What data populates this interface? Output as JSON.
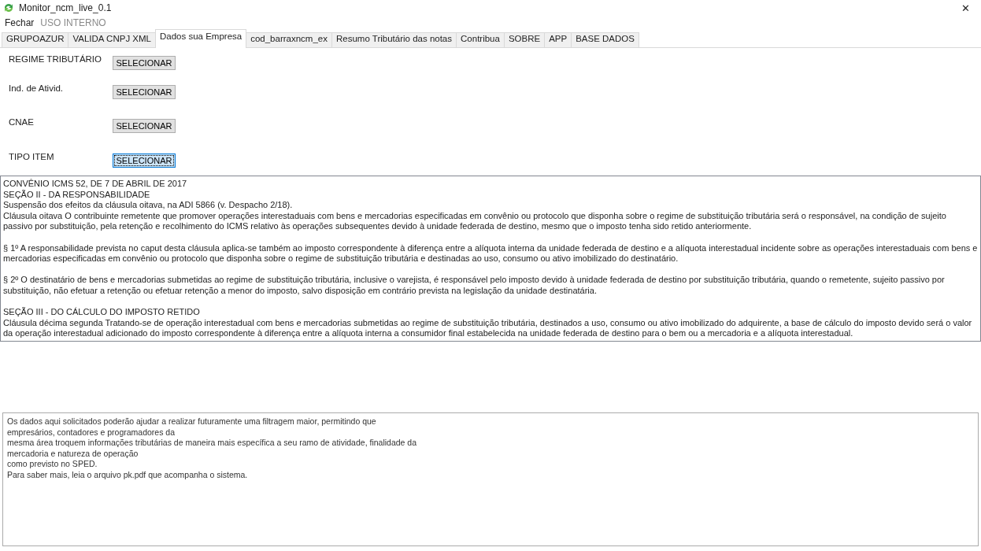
{
  "window": {
    "title": "Monitor_ncm_live_0.1",
    "close": "✕"
  },
  "menu": [
    {
      "label": "Fechar",
      "disabled": false
    },
    {
      "label": "USO INTERNO",
      "disabled": true
    }
  ],
  "tabs": [
    {
      "label": "GRUPOAZUR",
      "selected": false
    },
    {
      "label": "VALIDA CNPJ XML",
      "selected": false
    },
    {
      "label": "Dados sua Empresa",
      "selected": true
    },
    {
      "label": "cod_barraxncm_ex",
      "selected": false
    },
    {
      "label": "Resumo Tributário das notas",
      "selected": false
    },
    {
      "label": "Contribua",
      "selected": false
    },
    {
      "label": "SOBRE",
      "selected": false
    },
    {
      "label": "APP",
      "selected": false
    },
    {
      "label": "BASE DADOS",
      "selected": false
    }
  ],
  "form": [
    {
      "label": "REGIME TRIBUTÁRIO",
      "button": "SELECIONAR",
      "focused": false
    },
    {
      "label": "Ind. de Ativid.",
      "button": "SELECIONAR",
      "focused": false
    },
    {
      "label": "CNAE",
      "button": "SELECIONAR",
      "focused": false
    },
    {
      "label": "TIPO ITEM",
      "button": "SELECIONAR",
      "focused": true
    }
  ],
  "legal_text": [
    [
      "CONVÊNIO ICMS 52, DE 7 DE ABRIL DE 2017",
      "SEÇÃO II - DA RESPONSABILIDADE",
      "Suspensão dos efeitos da cláusula oitava, na ADI 5866 (v. Despacho 2/18).",
      "Cláusula oitava O contribuinte remetente que promover operações interestaduais com bens e mercadorias especificadas em convênio ou protocolo que disponha sobre o regime de substituição tributária será o responsável, na condição de sujeito passivo por substituição, pela retenção e recolhimento do ICMS relativo às operações subsequentes devido à unidade federada de destino, mesmo que o imposto tenha sido retido anteriormente."
    ],
    [
      "§ 1º A responsabilidade prevista no caput desta cláusula aplica-se também ao imposto correspondente à diferença entre a alíquota interna da unidade federada de destino e a alíquota interestadual incidente sobre as operações interestaduais com bens e mercadorias especificadas em convênio ou protocolo que disponha sobre o regime de substituição tributária e destinadas ao uso, consumo ou ativo imobilizado do destinatário."
    ],
    [
      "§ 2º O destinatário de bens e mercadorias submetidas ao regime de substituição tributária, inclusive o varejista, é responsável pelo imposto devido à unidade federada de destino por substituição tributária, quando o remetente, sujeito passivo por substituição, não efetuar a retenção ou efetuar retenção a menor do imposto, salvo disposição em contrário prevista na legislação da unidade destinatária."
    ],
    [
      "SEÇÃO III - DO CÁLCULO DO IMPOSTO RETIDO",
      "Cláusula décima segunda Tratando-se de operação interestadual com bens e mercadorias submetidas ao regime de substituição tributária, destinados a uso, consumo ou ativo imobilizado do adquirente, a base de cálculo do imposto devido será o valor da operação interestadual adicionado do imposto correspondente à diferença entre a alíquota interna a consumidor final estabelecida na unidade federada de destino para o bem ou a mercadoria e a alíquota interestadual."
    ]
  ],
  "note": "Os dados aqui solicitados poderão ajudar a realizar futuramente uma filtragem maior, permitindo que\nempresários, contadores e programadores da\nmesma área troquem informações tributárias de maneira mais específica a seu ramo de atividade, finalidade da\nmercadoria e natureza de operação\ncomo previsto no SPED.\nPara saber mais, leia o arquivo pk.pdf que acompanha o sistema."
}
